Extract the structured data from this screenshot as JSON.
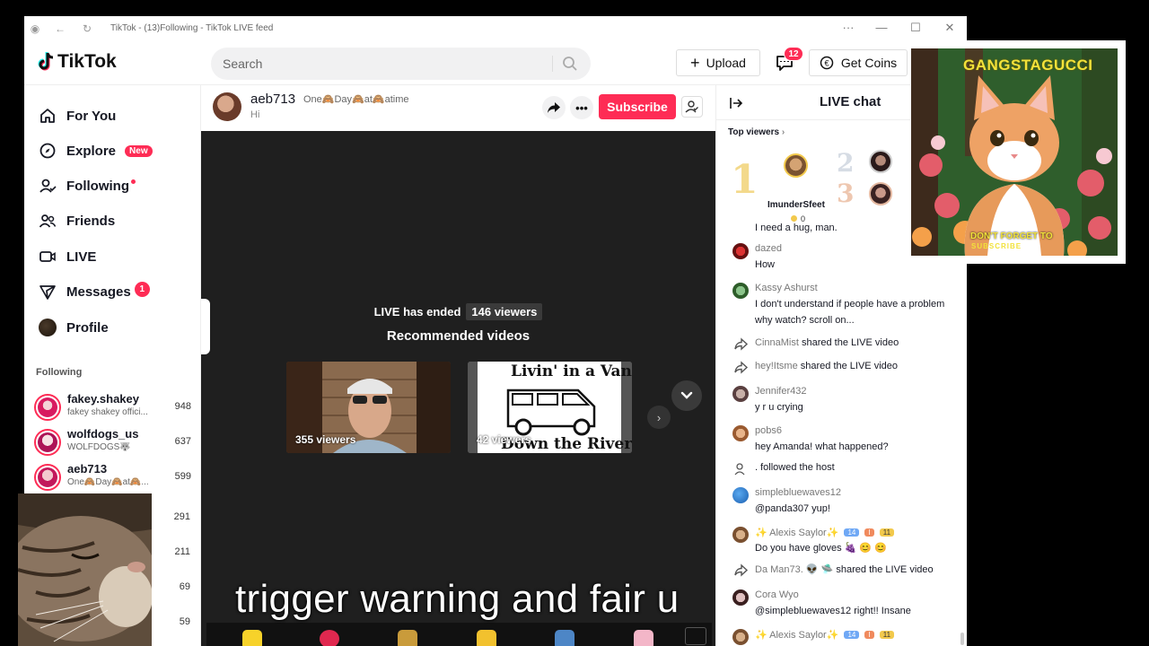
{
  "window": {
    "title": "TikTok - (13)Following - TikTok LIVE feed",
    "controls": {
      "more": "···",
      "minimize": "—",
      "maximize": "☐",
      "close": "✕"
    }
  },
  "header": {
    "logo": "TikTok",
    "search_placeholder": "Search",
    "upload_label": "Upload",
    "inbox_badge": "12",
    "coins_label": "Get Coins"
  },
  "sidebar": {
    "nav": [
      {
        "label": "For You",
        "icon": "home-icon"
      },
      {
        "label": "Explore",
        "icon": "compass-icon",
        "badge": "New"
      },
      {
        "label": "Following",
        "icon": "user-follow-icon",
        "dot": true
      },
      {
        "label": "Friends",
        "icon": "friends-icon"
      },
      {
        "label": "LIVE",
        "icon": "live-icon"
      },
      {
        "label": "Messages",
        "icon": "send-icon",
        "badge": "1"
      },
      {
        "label": "Profile",
        "icon": "avatar"
      }
    ],
    "following_heading": "Following",
    "following": [
      {
        "name": "fakey.shakey",
        "sub": "fakey shakey offici...",
        "count": "948"
      },
      {
        "name": "wolfdogs_us",
        "sub": "WOLFDOGS🐺",
        "count": "637"
      },
      {
        "name": "aeb713",
        "sub": "One🙈Day🙈at🙈...",
        "count": "599"
      }
    ],
    "extra_counts": [
      "291",
      "211",
      "69",
      "59"
    ]
  },
  "live": {
    "host_name": "aeb713",
    "host_bio": "One🙈Day🙈at🙈atime",
    "host_subtitle": "Hi",
    "subscribe_label": "Subscribe",
    "ended_text": "LIVE has ended",
    "ended_viewers": "146 viewers",
    "recommended_title": "Recommended videos",
    "recommended": [
      {
        "viewers": "355 viewers"
      },
      {
        "viewers": "42 viewers",
        "art_top": "Livin' in a Van",
        "art_bottom": "Down the River"
      }
    ],
    "next_label": "›"
  },
  "chat": {
    "title": "LIVE chat",
    "top_viewers_label": "Top viewers",
    "top_viewers": [
      {
        "rank": "1",
        "name": "ImunderSfeet",
        "coins": "0"
      },
      {
        "rank": "2"
      },
      {
        "rank": "3"
      }
    ],
    "messages": [
      {
        "type": "text",
        "name": "",
        "text": "I need a hug, man."
      },
      {
        "type": "text",
        "name": "dazed",
        "text": "How"
      },
      {
        "type": "text",
        "name": "Kassy Ashurst",
        "text": "I don't understand if people have a problem why watch? scroll on..."
      },
      {
        "type": "share",
        "name": "CinnaMist",
        "text": "shared the LIVE video"
      },
      {
        "type": "share",
        "name": "hey!Itsme",
        "text": "shared the LIVE video"
      },
      {
        "type": "text",
        "name": "Jennifer432",
        "text": "y r u crying"
      },
      {
        "type": "text",
        "name": "pobs6",
        "text": "hey Amanda! what happened?"
      },
      {
        "type": "follow",
        "name": ".",
        "text": "followed the host"
      },
      {
        "type": "text",
        "name": "simplebluewaves12",
        "text": "@panda307 yup!"
      },
      {
        "type": "text",
        "name": "✨ Alexis Saylor✨",
        "text": "Do you have gloves 🍇 😊 😊",
        "levels": [
          "14",
          "I",
          "11"
        ]
      },
      {
        "type": "share",
        "name": "Da Man73. 👽 🛸",
        "text": "shared the LIVE video"
      },
      {
        "type": "text",
        "name": "Cora Wyo",
        "text": "@simplebluewaves12 right!! Insane"
      },
      {
        "type": "text",
        "name": "✨ Alexis Saylor✨",
        "text": "",
        "levels": [
          "14",
          "I",
          "11"
        ]
      }
    ]
  },
  "overlays": {
    "cat_art_top_text": "GANGSTAGUCCI",
    "cat_art_bottom_line1": "DON'T FORGET TO",
    "cat_art_bottom_line2": "SUBSCRIBE",
    "caption": "trigger warning and fair u"
  },
  "colors": {
    "brand_red": "#fe2c55",
    "player_bg": "#1f1f1f",
    "text_dark": "#161823"
  }
}
